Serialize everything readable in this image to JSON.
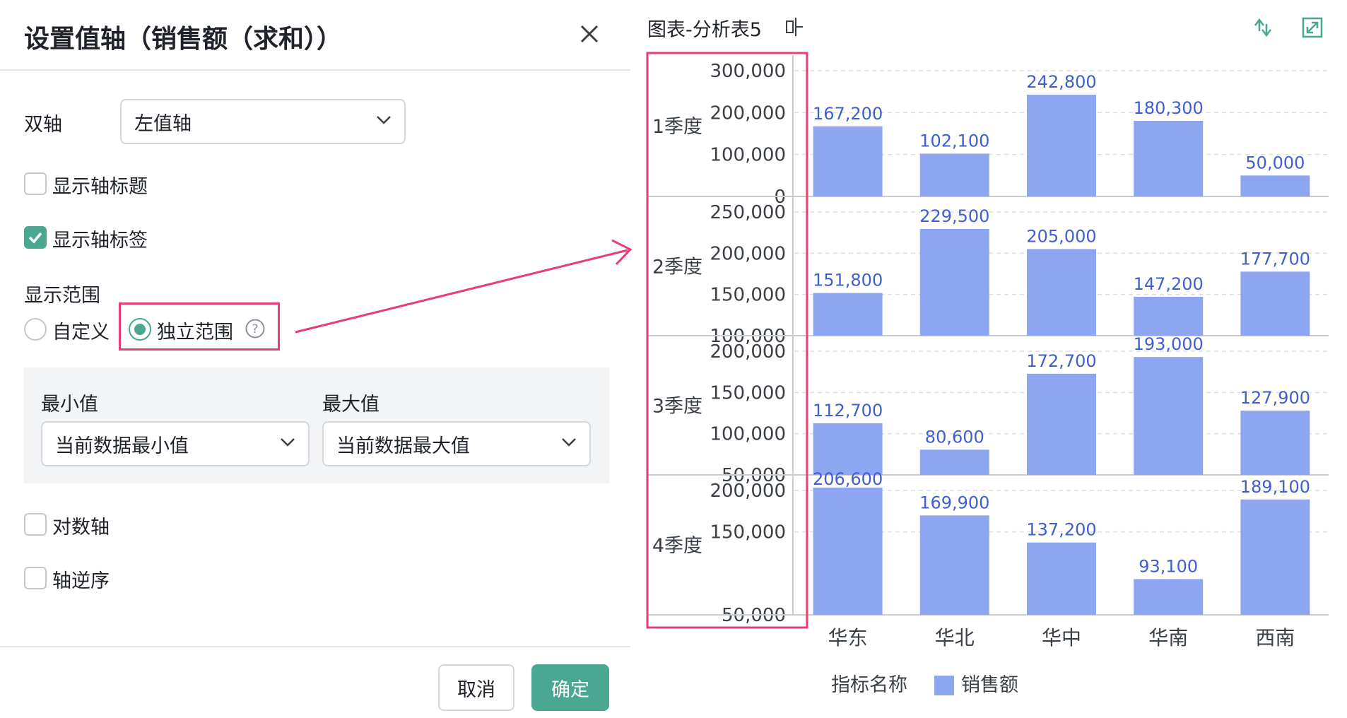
{
  "dialog": {
    "title": "设置值轴（销售额（求和））",
    "dual_axis_label": "双轴",
    "dual_axis_value": "左值轴",
    "show_axis_title": {
      "label": "显示轴标题",
      "checked": false
    },
    "show_axis_labels": {
      "label": "显示轴标签",
      "checked": true
    },
    "range_label": "显示范围",
    "range_options": [
      {
        "label": "自定义",
        "selected": false
      },
      {
        "label": "独立范围",
        "selected": true
      }
    ],
    "min": {
      "label": "最小值",
      "value": "当前数据最小值"
    },
    "max": {
      "label": "最大值",
      "value": "当前数据最大值"
    },
    "log_axis": {
      "label": "对数轴",
      "checked": false
    },
    "reverse_axis": {
      "label": "轴逆序",
      "checked": false
    },
    "cancel_label": "取消",
    "ok_label": "确定"
  },
  "colors": {
    "accent": "#4aa892",
    "bar": "#8ea6f2",
    "bar_label": "#3f5fcf",
    "highlight": "#e83e74"
  },
  "chart_header": {
    "title": "图表-分析表5",
    "icons": [
      "axis-swap-icon",
      "sort-icon",
      "expand-icon"
    ]
  },
  "chart_data": {
    "type": "bar",
    "categories": [
      "华东",
      "华北",
      "华中",
      "华南",
      "西南"
    ],
    "legend_title": "指标名称",
    "legend_position": "bottom",
    "series_name": "销售额",
    "grid": true,
    "panels": [
      {
        "label": "1季度",
        "values": [
          167200,
          102100,
          242800,
          180300,
          50000
        ],
        "ylim": [
          0,
          300000
        ],
        "ticks": [
          "300,000",
          "200,000",
          "100,000",
          "0"
        ],
        "tick_values": [
          300000,
          200000,
          100000,
          0
        ]
      },
      {
        "label": "2季度",
        "values": [
          151800,
          229500,
          205000,
          147200,
          177700
        ],
        "ylim": [
          100000,
          250000
        ],
        "ticks": [
          "250,000",
          "200,000",
          "150,000",
          "100,000"
        ],
        "tick_values": [
          250000,
          200000,
          150000,
          100000
        ]
      },
      {
        "label": "3季度",
        "values": [
          112700,
          80600,
          172700,
          193000,
          127900
        ],
        "ylim": [
          50000,
          200000
        ],
        "ticks": [
          "200,000",
          "150,000",
          "100,000",
          "50,000"
        ],
        "tick_values": [
          200000,
          150000,
          100000,
          50000
        ]
      },
      {
        "label": "4季度",
        "values": [
          206600,
          169900,
          137200,
          93100,
          189100
        ],
        "ylim": [
          50000,
          200000
        ],
        "ticks": [
          "200,000",
          "150,000",
          "50,000"
        ],
        "tick_values": [
          200000,
          150000,
          50000
        ]
      }
    ],
    "value_labels": [
      [
        "167,200",
        "102,100",
        "242,800",
        "180,300",
        "50,000"
      ],
      [
        "151,800",
        "229,500",
        "205,000",
        "147,200",
        "177,700"
      ],
      [
        "112,700",
        "80,600",
        "172,700",
        "193,000",
        "127,900"
      ],
      [
        "206,600",
        "169,900",
        "137,200",
        "93,100",
        "189,100"
      ]
    ]
  }
}
